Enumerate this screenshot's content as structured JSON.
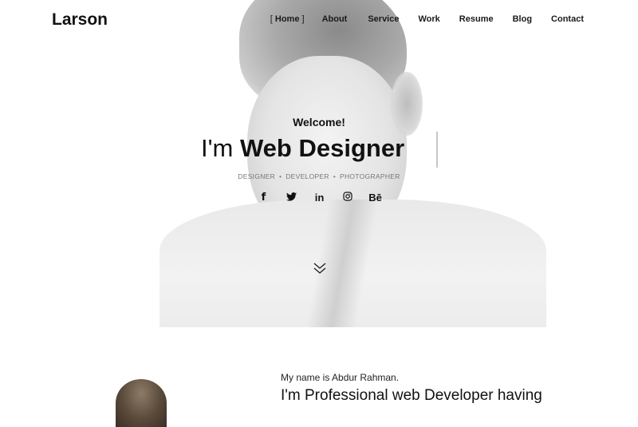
{
  "brand": {
    "logo": "Larson"
  },
  "nav": {
    "items": [
      {
        "label": "Home",
        "active": true
      },
      {
        "label": "About"
      },
      {
        "label": "Service"
      },
      {
        "label": "Work"
      },
      {
        "label": "Resume"
      },
      {
        "label": "Blog"
      },
      {
        "label": "Contact"
      }
    ],
    "active_open_bracket": "[",
    "active_close_bracket": "]"
  },
  "hero": {
    "welcome": "Welcome!",
    "headline_prefix": "I'm",
    "headline_typed": "Web Designer",
    "roles": [
      "DESIGNER",
      "DEVELOPER",
      "PHOTOGRAPHER"
    ],
    "role_separator": "•",
    "social": [
      {
        "icon": "facebook-icon",
        "glyph": "f"
      },
      {
        "icon": "twitter-icon",
        "glyph": "🐦"
      },
      {
        "icon": "linkedin-icon",
        "glyph": "in"
      },
      {
        "icon": "instagram-icon",
        "glyph": "◎"
      },
      {
        "icon": "behance-icon",
        "glyph": "Bē"
      }
    ],
    "scroll_icon": "double-chevron-down-icon"
  },
  "about": {
    "intro": "My name is Abdur Rahman.",
    "title": "I'm Professional web Developer having"
  }
}
